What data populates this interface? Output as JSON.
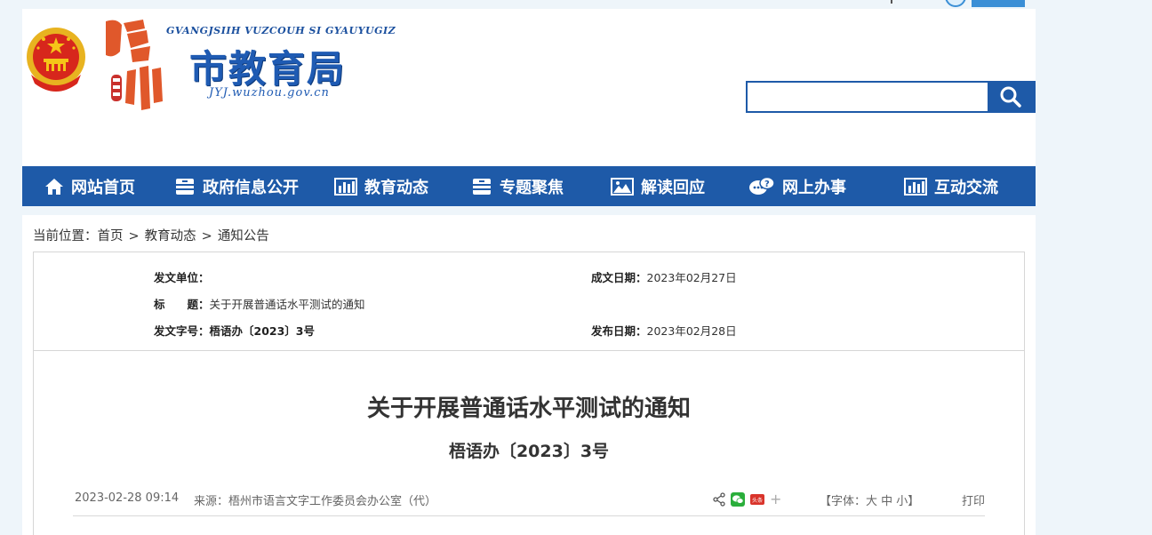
{
  "site": {
    "pinyin": "GVANGJSIIH VUZCOUH SI GYAUYUGIZ",
    "title": "市教育局",
    "url": "JYJ.wuzhou.gov.cn",
    "city_chars": "梧州"
  },
  "search": {
    "value": "",
    "placeholder": ""
  },
  "nav": {
    "items": [
      {
        "label": "网站首页",
        "icon": "home-icon"
      },
      {
        "label": "政府信息公开",
        "icon": "cabinet-icon"
      },
      {
        "label": "教育动态",
        "icon": "bar-chart-icon"
      },
      {
        "label": "专题聚焦",
        "icon": "cabinet-icon"
      },
      {
        "label": "解读回应",
        "icon": "picture-icon"
      },
      {
        "label": "网上办事",
        "icon": "chat-icon"
      },
      {
        "label": "互动交流",
        "icon": "bar-chart-icon"
      }
    ]
  },
  "breadcrumb": {
    "prefix": "当前位置：",
    "items": [
      "首页",
      "教育动态",
      "通知公告"
    ],
    "sep": ">"
  },
  "meta": {
    "issuer_label": "发文单位：",
    "issuer_value": "",
    "created_label": "成文日期：",
    "created_value": "2023年02月27日",
    "title_label": "标　　题：",
    "title_value": "关于开展普通话水平测试的通知",
    "docno_label": "发文字号：",
    "docno_value": "梧语办〔2023〕3号",
    "published_label": "发布日期：",
    "published_value": "2023年02月28日"
  },
  "article": {
    "title": "关于开展普通话水平测试的通知",
    "subtitle": "梧语办〔2023〕3号",
    "datetime": "2023-02-28 09:14",
    "source": "来源：梧州市语言文字工作委员会办公室（代）",
    "font_label": "【字体：大 中 小】",
    "print_label": "打印",
    "plus": "+",
    "share_icons": [
      "share-icon",
      "wechat-icon",
      "weibo-icon"
    ],
    "weibo_text": "头条"
  },
  "colors": {
    "brand_blue": "#1e5aa8",
    "page_bg": "#eef5fa"
  }
}
